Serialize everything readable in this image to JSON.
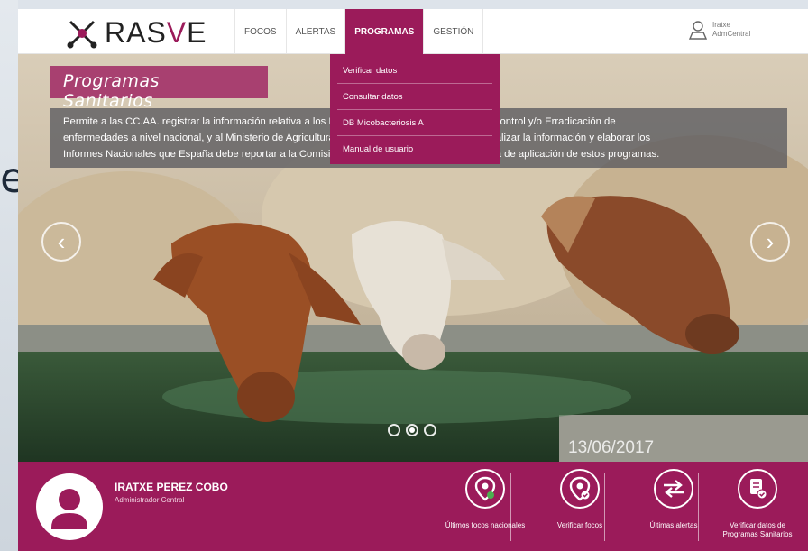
{
  "app": {
    "brand_prefix": "RAS",
    "brand_accent": "V",
    "brand_suffix": "E",
    "accent_color": "#9b1b5a"
  },
  "nav": {
    "items": [
      "FOCOS",
      "ALERTAS",
      "PROGRAMAS",
      "GESTIÓN"
    ],
    "active": "PROGRAMAS"
  },
  "user": {
    "name": "Iratxe",
    "role": "AdmCentral",
    "icon": "user-icon"
  },
  "dropdown": {
    "items": [
      "Verificar datos",
      "Consultar datos",
      "DB Micobacteriosis A",
      "Manual de usuario"
    ]
  },
  "hero": {
    "title": "Programas Sanitarios",
    "line1": "Permite a las CC.AA. registrar la información relativa a los Programas Sanitarios de Vigilancia, Control y/o Erradicación de",
    "line2": "enfermedades a nivel nacional, y al Ministerio de Agricultura, Alimentación y Medio Ambiente analizar la información y elaborar los",
    "line3": "Informes Nacionales que España debe reportar a la Comisión Europea en el marco de la eficacia de aplicación de estos programas.",
    "date": "13/06/2017",
    "slides": 3,
    "active_slide": 2
  },
  "footer": {
    "user_name": "IRATXE PEREZ COBO",
    "user_role": "Administrador Central",
    "links": [
      {
        "label": "Últimos focos nacionales",
        "icon": "map-pin-icon"
      },
      {
        "label": "Verificar focos",
        "icon": "map-pin-check-icon"
      },
      {
        "label": "Últimas alertas",
        "icon": "alert-arrows-icon"
      },
      {
        "label": "Verificar datos de",
        "label2": "Programas Sanitarios",
        "icon": "document-check-icon"
      }
    ]
  }
}
